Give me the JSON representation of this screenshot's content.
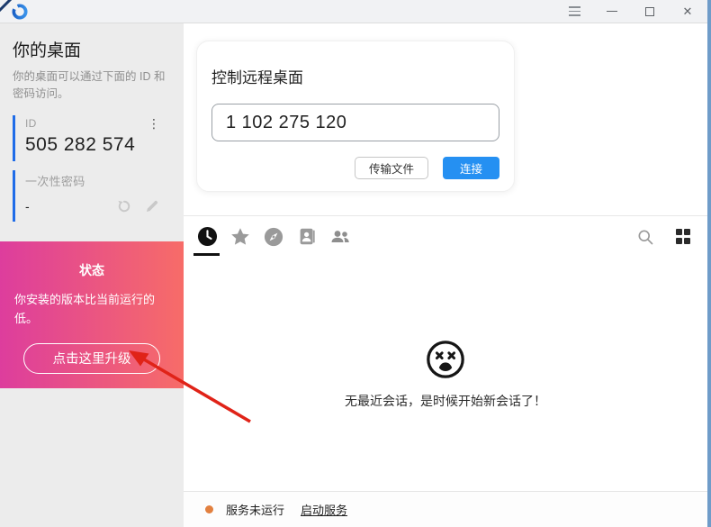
{
  "titlebar": {
    "logo": "app-logo-ring",
    "controls": [
      "hamburger-menu",
      "minimize",
      "maximize",
      "close"
    ]
  },
  "sidebar": {
    "title": "你的桌面",
    "description": "你的桌面可以通过下面的 ID 和密码访问。",
    "id_section": {
      "label": "ID",
      "value": "505 282 574",
      "menu_icon": "kebab-menu"
    },
    "password_section": {
      "label": "一次性密码",
      "value": "-",
      "icons": [
        "refresh-icon",
        "edit-pencil-icon"
      ]
    },
    "status_panel": {
      "title": "状态",
      "message": "你安装的版本比当前运行的低。",
      "upgrade_button": "点击这里升级"
    }
  },
  "main": {
    "connect_card": {
      "title": "控制远程桌面",
      "id_input_value": "1 102 275 120",
      "transfer_button": "传输文件",
      "connect_button": "连接"
    },
    "tabs": [
      "recent-sessions-clock",
      "favorites-star",
      "discovered-compass",
      "address-book",
      "group"
    ],
    "toolbar_icons": [
      "search-icon",
      "grid-view-icon"
    ],
    "empty_state": {
      "icon": "dizzy-face",
      "message": "无最近会话，是时候开始新会话了！"
    },
    "statusbar": {
      "status_text": "服务未运行",
      "action_link": "启动服务"
    }
  },
  "annotation": {
    "arrow": "red arrow pointing to upgrade button"
  },
  "colors": {
    "accent_blue": "#1f6ce8",
    "connect_blue": "#2590f2",
    "gradient_left": "#dd3d9d",
    "gradient_right": "#f76c68",
    "arrow_red": "#e02318",
    "status_dot_orange": "#e2803f",
    "icon_gray": "#9e9e9e",
    "window_border_blue": "#6f9cc9"
  }
}
